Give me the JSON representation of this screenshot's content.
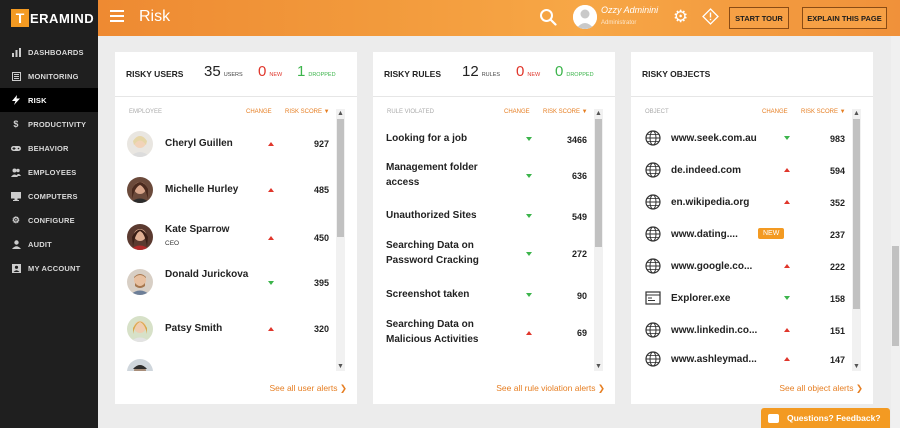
{
  "app": {
    "logo_letter": "T",
    "logo_text": "ERAMIND"
  },
  "sidebar": {
    "items": [
      {
        "label": "DASHBOARDS",
        "icon": "dashboard-icon"
      },
      {
        "label": "MONITORING",
        "icon": "monitor-icon"
      },
      {
        "label": "RISK",
        "icon": "bolt-icon",
        "active": true
      },
      {
        "label": "PRODUCTIVITY",
        "icon": "dollar-icon"
      },
      {
        "label": "BEHAVIOR",
        "icon": "gamepad-icon"
      },
      {
        "label": "EMPLOYEES",
        "icon": "users-icon"
      },
      {
        "label": "COMPUTERS",
        "icon": "desktop-icon"
      },
      {
        "label": "CONFIGURE",
        "icon": "gear-icon"
      },
      {
        "label": "AUDIT",
        "icon": "user-shield-icon"
      },
      {
        "label": "MY ACCOUNT",
        "icon": "id-card-icon"
      }
    ]
  },
  "header": {
    "title": "Risk",
    "user_name": "Ozzy Adminini",
    "user_role": "Administrator",
    "start_tour": "START TOUR",
    "explain": "EXPLAIN THIS PAGE"
  },
  "users_panel": {
    "title": "RISKY USERS",
    "count": "35",
    "count_label": "USERS",
    "new": "0",
    "new_label": "NEW",
    "dropped": "1",
    "dropped_label": "DROPPED",
    "col_left": "EMPLOYEE",
    "col_change": "CHANGE",
    "col_risk": "RISK SCORE ▼",
    "rows": [
      {
        "name": "Cheryl Guillen",
        "sub": "",
        "change": "up",
        "score": "927"
      },
      {
        "name": "Michelle Hurley",
        "sub": "",
        "change": "up",
        "score": "485"
      },
      {
        "name": "Kate Sparrow",
        "sub": "CEO",
        "change": "up",
        "score": "450"
      },
      {
        "name": "Donald Jurickova",
        "sub": "",
        "change": "down",
        "score": "395"
      },
      {
        "name": "Patsy Smith",
        "sub": "",
        "change": "up",
        "score": "320"
      }
    ],
    "see_all": "See all user alerts"
  },
  "rules_panel": {
    "title": "RISKY RULES",
    "count": "12",
    "count_label": "RULES",
    "new": "0",
    "new_label": "NEW",
    "dropped": "0",
    "dropped_label": "DROPPED",
    "col_left": "RULE VIOLATED",
    "col_change": "CHANGE",
    "col_risk": "RISK SCORE ▼",
    "rows": [
      {
        "name": "Looking for a job",
        "change": "down",
        "score": "3466"
      },
      {
        "name": "Management folder access",
        "change": "down",
        "score": "636"
      },
      {
        "name": "Unauthorized Sites",
        "change": "down",
        "score": "549"
      },
      {
        "name": "Searching Data on Password Cracking",
        "change": "down",
        "score": "272"
      },
      {
        "name": "Screenshot taken",
        "change": "down",
        "score": "90"
      },
      {
        "name": "Searching Data on Malicious Activities",
        "change": "up",
        "score": "69"
      }
    ],
    "see_all": "See all rule violation alerts"
  },
  "objects_panel": {
    "title": "RISKY OBJECTS",
    "col_left": "OBJECT",
    "col_change": "CHANGE",
    "col_risk": "RISK SCORE ▼",
    "rows": [
      {
        "name": "www.seek.com.au",
        "icon": "globe-icon",
        "change": "down",
        "score": "983"
      },
      {
        "name": "de.indeed.com",
        "icon": "globe-icon",
        "change": "up",
        "score": "594"
      },
      {
        "name": "en.wikipedia.org",
        "icon": "globe-icon",
        "change": "up",
        "score": "352"
      },
      {
        "name": "www.dating....",
        "icon": "globe-icon",
        "badge": "NEW",
        "change": "",
        "score": "237"
      },
      {
        "name": "www.google.co...",
        "icon": "globe-icon",
        "change": "up",
        "score": "222"
      },
      {
        "name": "Explorer.exe",
        "icon": "application-icon",
        "change": "down",
        "score": "158"
      },
      {
        "name": "www.linkedin.co...",
        "icon": "globe-icon",
        "change": "up",
        "score": "151"
      },
      {
        "name": "www.ashleymad...",
        "icon": "globe-icon",
        "change": "up",
        "score": "147"
      }
    ],
    "see_all": "See all object alerts"
  },
  "feedback": "Questions? Feedback?"
}
